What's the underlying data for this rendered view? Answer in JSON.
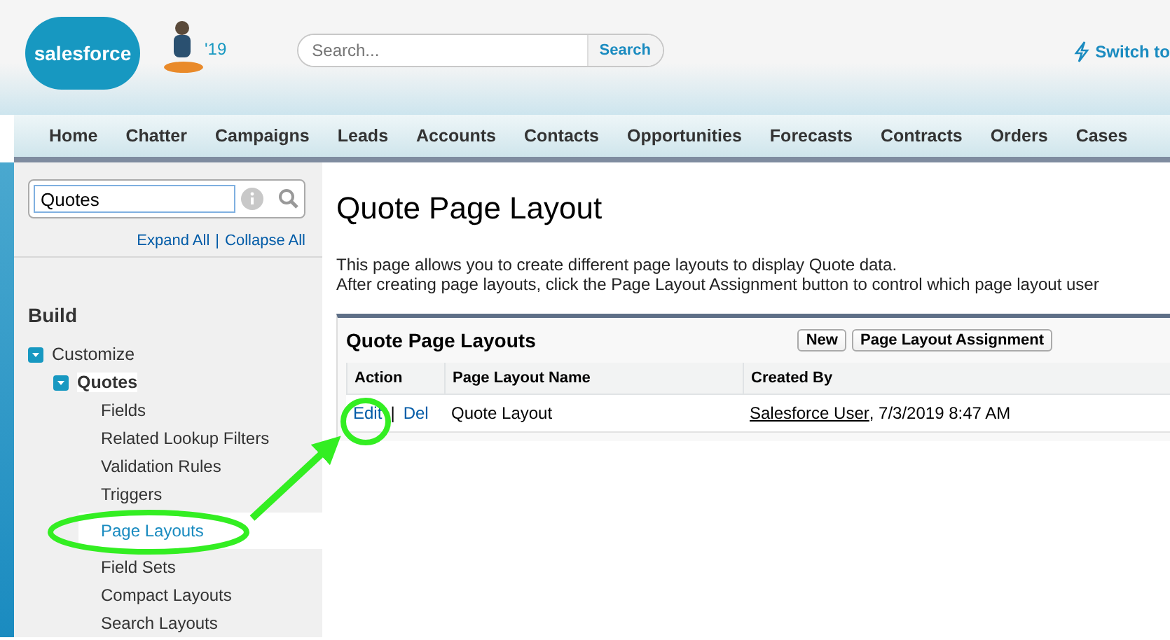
{
  "header": {
    "logo_text": "salesforce",
    "release_badge": "'19",
    "search": {
      "placeholder": "Search...",
      "button": "Search"
    },
    "switch_link": "Switch to"
  },
  "nav_tabs": [
    {
      "label": "Home"
    },
    {
      "label": "Chatter"
    },
    {
      "label": "Campaigns"
    },
    {
      "label": "Leads"
    },
    {
      "label": "Accounts"
    },
    {
      "label": "Contacts"
    },
    {
      "label": "Opportunities"
    },
    {
      "label": "Forecasts"
    },
    {
      "label": "Contracts"
    },
    {
      "label": "Orders"
    },
    {
      "label": "Cases"
    }
  ],
  "sidebar": {
    "search_value": "Quotes",
    "expand_all": "Expand All",
    "separator": "|",
    "collapse_all": "Collapse All",
    "section": "Build",
    "tree": [
      {
        "label": "Customize",
        "expanded": true,
        "children": [
          {
            "label": "Quotes",
            "expanded": true,
            "children": [
              {
                "label": "Fields",
                "selected": false
              },
              {
                "label": "Related Lookup Filters",
                "selected": false
              },
              {
                "label": "Validation Rules",
                "selected": false
              },
              {
                "label": "Triggers",
                "selected": false
              },
              {
                "label": "Page Layouts",
                "selected": true
              },
              {
                "label": "Field Sets",
                "selected": false
              },
              {
                "label": "Compact Layouts",
                "selected": false
              },
              {
                "label": "Search Layouts",
                "selected": false
              }
            ]
          }
        ]
      }
    ]
  },
  "page": {
    "title": "Quote Page Layout",
    "description": [
      "This page allows you to create different page layouts to display Quote data.",
      "After creating page layouts, click the Page Layout Assignment button to control which page layout user"
    ],
    "panel": {
      "title": "Quote Page Layouts",
      "buttons": [
        "New",
        "Page Layout Assignment"
      ],
      "columns": [
        "Action",
        "Page Layout Name",
        "Created By"
      ],
      "rows": [
        {
          "edit": "Edit",
          "separator": "|",
          "delete": "Del",
          "name": "Quote Layout",
          "creator": "Salesforce User",
          "created": ", 7/3/2019 8:47 AM"
        }
      ]
    }
  }
}
